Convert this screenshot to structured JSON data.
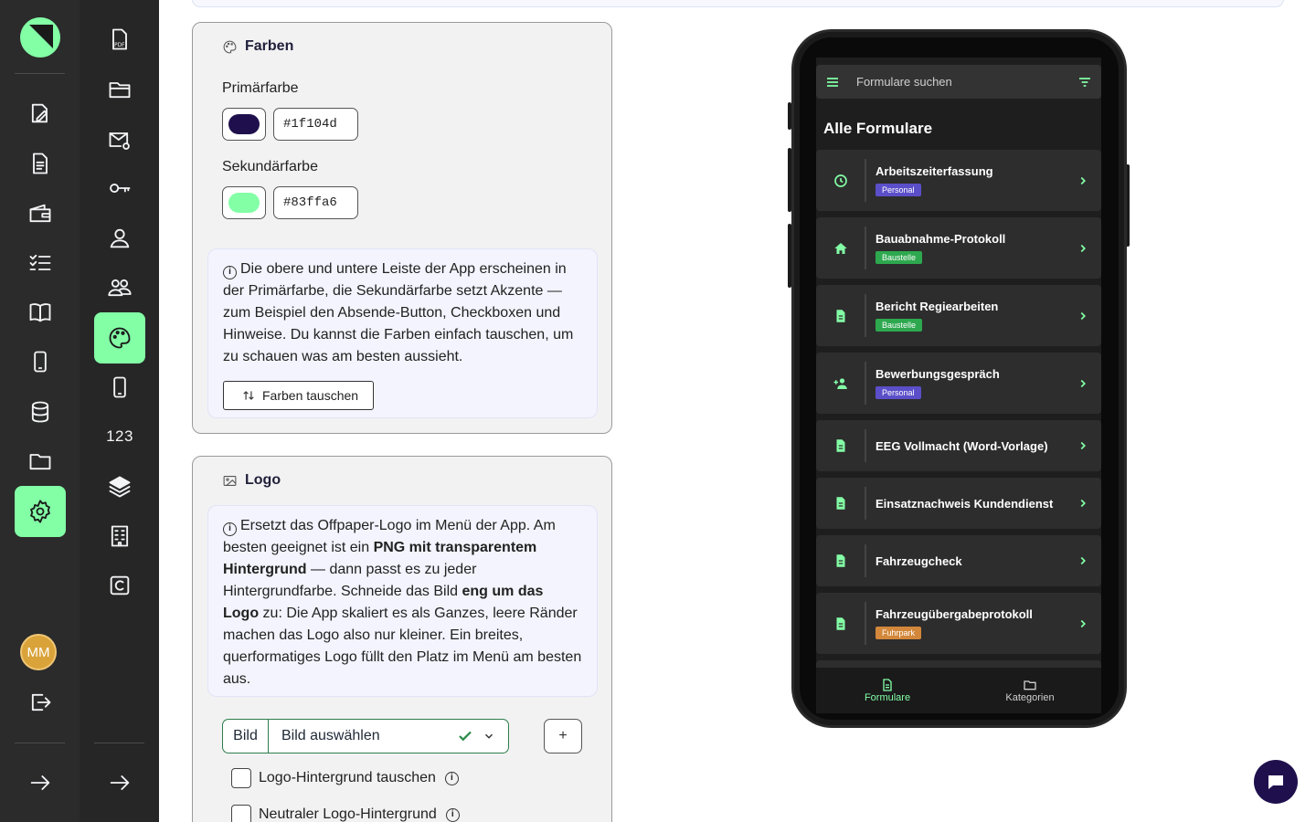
{
  "sidebar_main": {
    "items": [
      "edit-form-icon",
      "document-icon",
      "wallet-icon",
      "checklist-icon",
      "book-icon",
      "phone-icon",
      "database-icon",
      "folder-icon",
      "settings-icon"
    ],
    "active": "settings-icon",
    "avatar_initials": "MM"
  },
  "sidebar_sub": {
    "items": [
      "pdf-icon",
      "folder-open-icon",
      "mail-at-icon",
      "key-icon",
      "user-icon",
      "users-icon",
      "palette-icon",
      "mobile-icon",
      "numbers-label",
      "layers-icon",
      "building-icon",
      "copyright-icon"
    ],
    "numbers_label": "123",
    "active": "palette-icon"
  },
  "colors_card": {
    "title": "Farben",
    "primary_label": "Primärfarbe",
    "primary_value": "#1f104d",
    "secondary_label": "Sekundärfarbe",
    "secondary_value": "#83ffa6",
    "info_text": "Die obere und untere Leiste der App erscheinen in der Primärfarbe, die Sekundärfarbe setzt Akzente — zum Beispiel den Absende-Button, Checkboxen und Hinweise. Du kannst die Farben einfach tauschen, um zu schauen was am besten aussieht.",
    "swap_button": "Farben tauschen"
  },
  "logo_card": {
    "title": "Logo",
    "info_part1": "Ersetzt das Offpaper-Logo im Menü der App. Am besten geeignet ist ein ",
    "info_bold1": "PNG mit transparentem Hintergrund",
    "info_part2": " — dann passt es zu jeder Hintergrundfarbe. Schneide das Bild ",
    "info_bold2": "eng um das Logo",
    "info_part3": " zu: Die App skaliert es als Ganzes, leere Ränder machen das Logo also nur kleiner. Ein breites, querformatiges Logo füllt den Platz im Menü am besten aus.",
    "select_addon": "Bild",
    "select_value": "Bild auswählen",
    "plus_label": "+",
    "checkbox1": "Logo-Hintergrund tauschen",
    "checkbox2": "Neutraler Logo-Hintergrund"
  },
  "phone_preview": {
    "search_placeholder": "Formulare suchen",
    "heading": "Alle Formulare",
    "accent": "#83ffa6",
    "items": [
      {
        "name": "Arbeitszeiterfassung",
        "tag": "Personal",
        "tag_color": "#5b4fc9",
        "icon": "clock-icon"
      },
      {
        "name": "Bauabnahme-Protokoll",
        "tag": "Baustelle",
        "tag_color": "#2ea84f",
        "icon": "home-icon"
      },
      {
        "name": "Bericht Regiearbeiten",
        "tag": "Baustelle",
        "tag_color": "#2ea84f",
        "icon": "file-icon"
      },
      {
        "name": "Bewerbungsgespräch",
        "tag": "Personal",
        "tag_color": "#5b4fc9",
        "icon": "person-add-icon"
      },
      {
        "name": "EEG Vollmacht (Word-Vorlage)",
        "tag": "",
        "tag_color": "",
        "icon": "file-icon"
      },
      {
        "name": "Einsatznachweis Kundendienst",
        "tag": "",
        "tag_color": "",
        "icon": "file-icon"
      },
      {
        "name": "Fahrzeugcheck",
        "tag": "",
        "tag_color": "",
        "icon": "file-icon"
      },
      {
        "name": "Fahrzeugübergabeprotokoll",
        "tag": "Fuhrpark",
        "tag_color": "#d2873a",
        "icon": "file-icon"
      }
    ],
    "nav_forms": "Formulare",
    "nav_categories": "Kategorien"
  }
}
